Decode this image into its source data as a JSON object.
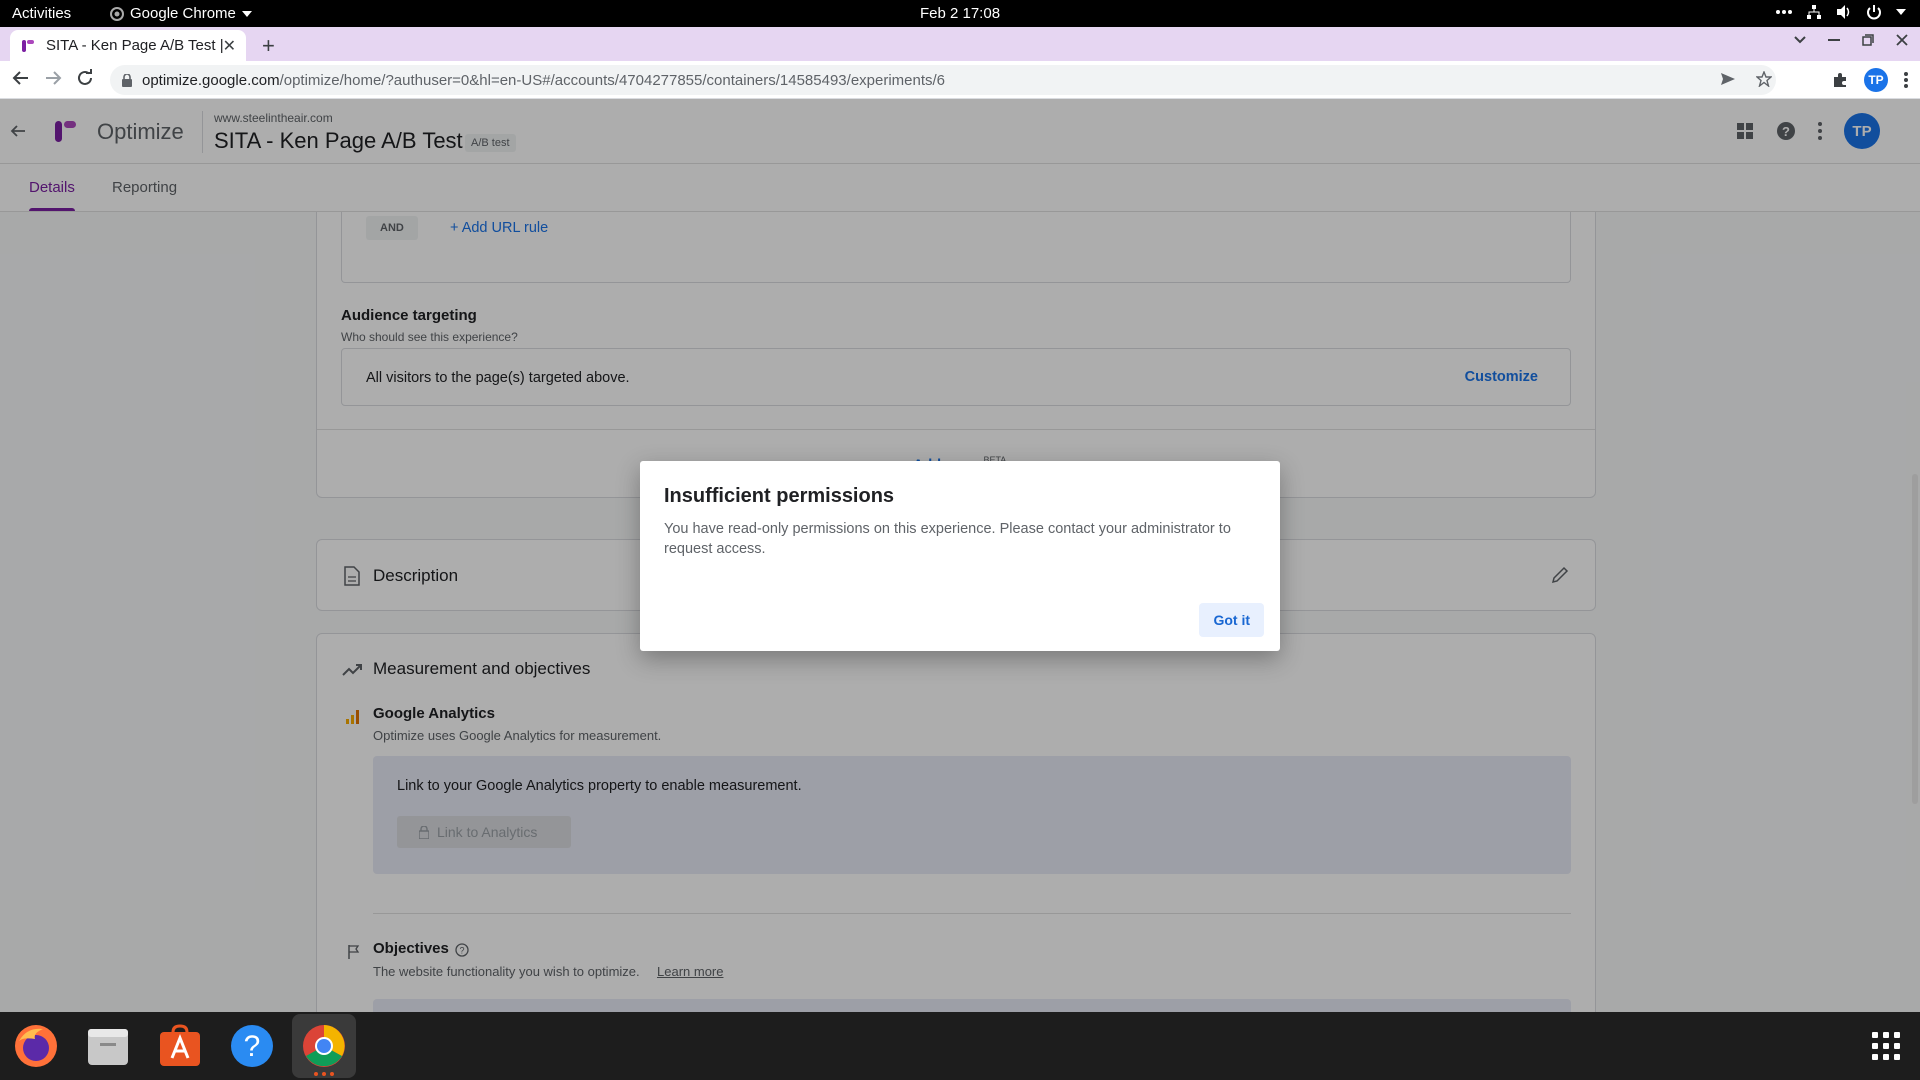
{
  "system_bar": {
    "activities": "Activities",
    "app_name": "Google Chrome",
    "clock": "Feb 2  17:08"
  },
  "browser": {
    "tab_title": "SITA - Ken Page A/B Test |",
    "url_host": "optimize.google.com",
    "url_path": "/optimize/home/?authuser=0&hl=en-US#/accounts/4704277855/containers/14585493/experiments/6",
    "profile_initials": "TP"
  },
  "app": {
    "name": "Optimize",
    "site": "www.steelintheair.com",
    "experiment_title": "SITA - Ken Page A/B Test",
    "experiment_type": "A/B test",
    "profile_initials": "TP",
    "tabs": [
      {
        "label": "Details",
        "active": true
      },
      {
        "label": "Reporting",
        "active": false
      }
    ]
  },
  "targeting": {
    "and_chip": "AND",
    "add_url_rule": "+ Add URL rule",
    "audience_title": "Audience targeting",
    "audience_sub": "Who should see this experience?",
    "audience_value": "All visitors to the page(s) targeted above.",
    "customize": "Customize",
    "add_page": "+ Add page",
    "beta": "BETA"
  },
  "description": {
    "title": "Description"
  },
  "measurement": {
    "title": "Measurement and objectives",
    "ga_title": "Google Analytics",
    "ga_sub": "Optimize uses Google Analytics for measurement.",
    "link_prompt": "Link to your Google Analytics property to enable measurement.",
    "link_button": "Link to Analytics",
    "objectives_title": "Objectives",
    "objectives_sub": "The website functionality you wish to optimize.",
    "learn_more": "Learn more"
  },
  "dialog": {
    "title": "Insufficient permissions",
    "body": "You have read-only permissions on this experience. Please contact your administrator to request access.",
    "button": "Got it"
  },
  "colors": {
    "accent_purple": "#7b1fa2",
    "link_blue": "#1a73e8",
    "tabstrip": "#e6d6f2"
  }
}
